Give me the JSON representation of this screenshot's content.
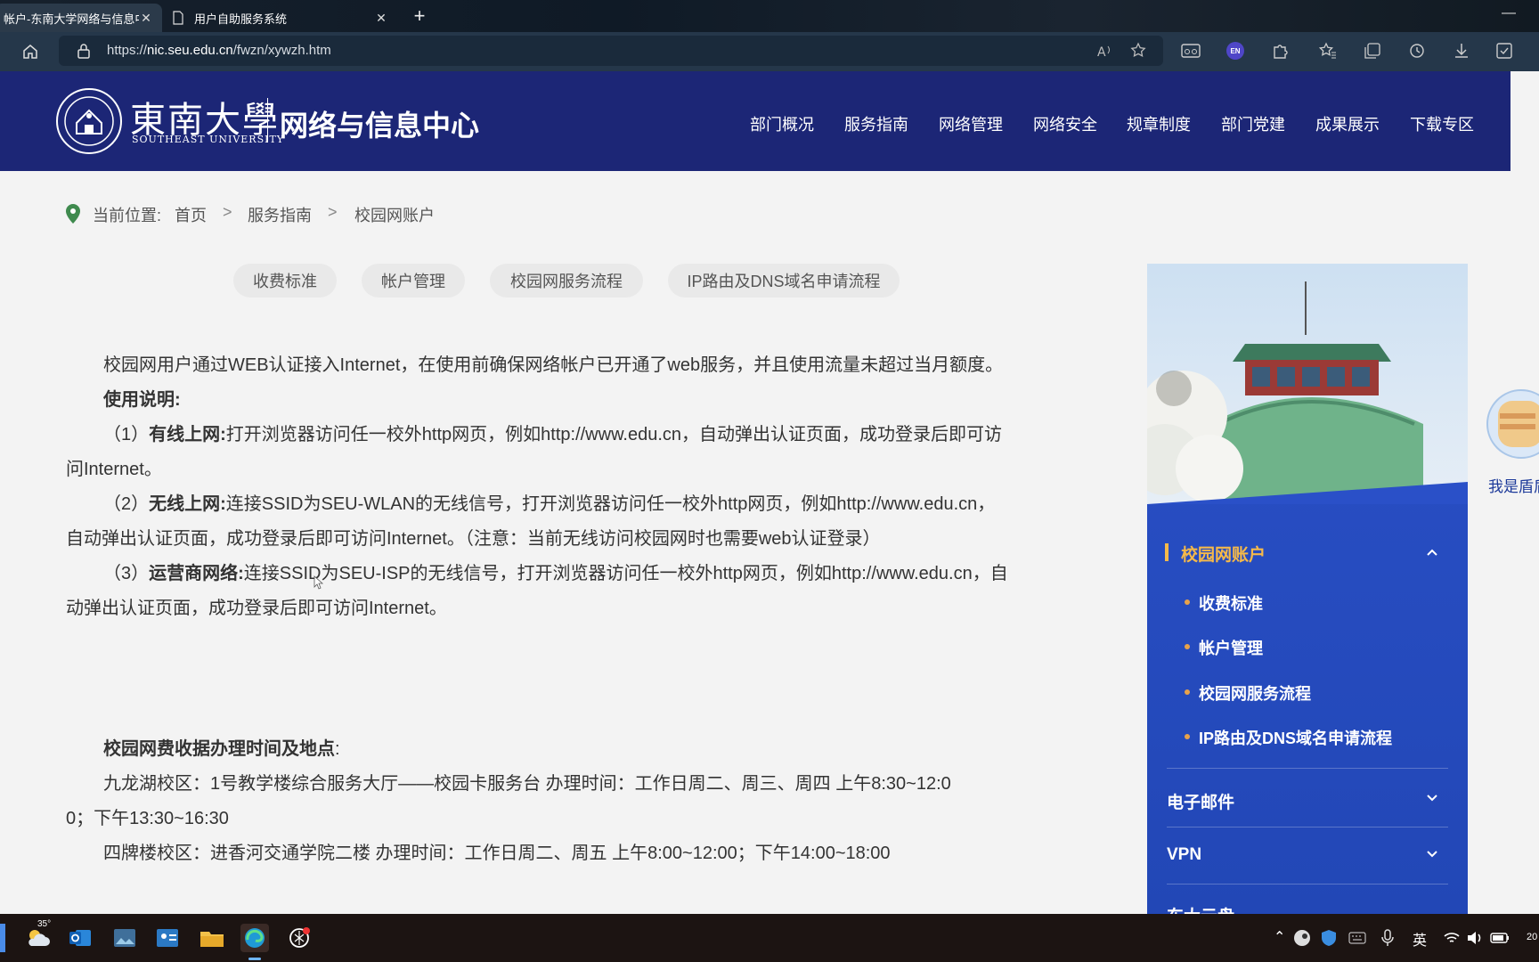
{
  "browser": {
    "tabs": [
      {
        "title": "帐户-东南大学网络与信息中心",
        "active": true
      },
      {
        "title": "用户自助服务系统",
        "active": false
      }
    ],
    "url_prefix": "https://",
    "url_host": "nic.seu.edu.cn",
    "url_path": "/fwzn/xywzh.htm",
    "translate_badge": "EN"
  },
  "site": {
    "logo_cn": "東南大學",
    "logo_en": "SOUTHEAST UNIVERSITY",
    "center_name": "网络与信息中心",
    "nav": [
      "部门概况",
      "服务指南",
      "网络管理",
      "网络安全",
      "规章制度",
      "部门党建",
      "成果展示",
      "下载专区"
    ]
  },
  "breadcrumb": {
    "label": "当前位置:",
    "home": "首页",
    "sep": ">",
    "level1": "服务指南",
    "level2": "校园网账户"
  },
  "subtabs": [
    "收费标准",
    "帐户管理",
    "校园网服务流程",
    "IP路由及DNS域名申请流程"
  ],
  "content": {
    "intro": "校园网用户通过WEB认证接入Internet，在使用前确保网络帐户已开通了web服务，并且使用流量未超过当月额度。",
    "usage_title": "使用说明:",
    "items": [
      {
        "num": "（1）",
        "label": "有线上网:",
        "line1": "打开浏览器访问任一校外http网页，例如http://www.edu.cn，自动弹出认证页面，成功登录后即可访",
        "line2": "问Internet。"
      },
      {
        "num": "（2）",
        "label": "无线上网:",
        "line1": "连接SSID为SEU-WLAN的无线信号，打开浏览器访问任一校外http网页，例如http://www.edu.cn，",
        "line2": "自动弹出认证页面，成功登录后即可访问Internet。（注意：当前无线访问校园网时也需要web认证登录）"
      },
      {
        "num": "（3）",
        "label": "运营商网络:",
        "line1": "连接SSID为SEU-ISP的无线信号，打开浏览器访问任一校外http网页，例如http://www.edu.cn，自",
        "line2": "动弹出认证页面，成功登录后即可访问Internet。"
      }
    ],
    "fee_title": "校园网费收据办理时间及地点",
    "fee_colon": ":",
    "jlh_line1": "九龙湖校区：1号教学楼综合服务大厅——校园卡服务台          办理时间：工作日周二、周三、周四  上午8:30~12:0",
    "jlh_line2": "0；下午13:30~16:30",
    "spl_line": "四牌楼校区：进香河交通学院二楼  办理时间：工作日周二、周五          上午8:00~12:00；下午14:00~18:00"
  },
  "sidebar": {
    "active_item": "校园网账户",
    "subitems": [
      "收费标准",
      "帐户管理",
      "校园网服务流程",
      "IP路由及DNS域名申请流程"
    ],
    "items": [
      "电子邮件",
      "VPN",
      "东大云盘"
    ]
  },
  "floating": {
    "label": "我是盾盾"
  },
  "taskbar": {
    "weather": "35°",
    "ime": "英",
    "clock_partial": "20"
  },
  "colors": {
    "header": "#1c2676",
    "sidebar": "#2a50c8",
    "accent": "#f5b94a",
    "location_icon": "#3f8a4e"
  }
}
